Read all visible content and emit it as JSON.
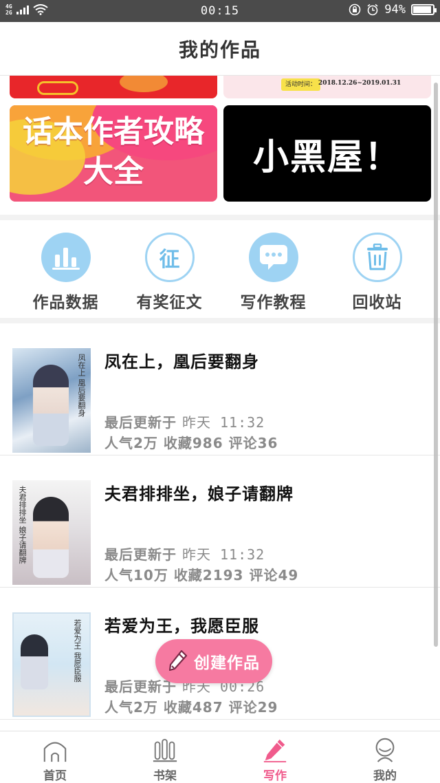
{
  "status_bar": {
    "network_top": "4G",
    "network_bottom": "2G",
    "time": "00:15",
    "battery": "94%",
    "battery_level": 0.94
  },
  "header": {
    "title": "我的作品"
  },
  "banners": {
    "strip_right_tag": "活动时间：",
    "strip_right_dates": "2018.12.26~2019.01.31",
    "pink_line1": "话本作者攻略",
    "pink_line2": "大全",
    "black_text": "小黑屋！"
  },
  "actions": [
    {
      "label": "作品数据",
      "icon": "chart-icon"
    },
    {
      "label": "有奖征文",
      "icon": "zheng-icon",
      "glyph": "征"
    },
    {
      "label": "写作教程",
      "icon": "message-icon"
    },
    {
      "label": "回收站",
      "icon": "trash-icon"
    }
  ],
  "works": [
    {
      "title": "凤在上，凰后要翻身",
      "updated_prefix": "最后更新于 ",
      "updated_time": "昨天 11:32",
      "popularity": "人气2万",
      "favorites": "收藏986",
      "comments": "评论36",
      "cover_text": "凤在上 凰后要翻身"
    },
    {
      "title": "夫君排排坐，娘子请翻牌",
      "updated_prefix": "最后更新于 ",
      "updated_time": "昨天 11:32",
      "popularity": "人气10万",
      "favorites": "收藏2193",
      "comments": "评论49",
      "cover_text": "夫君排排坐 娘子请翻牌"
    },
    {
      "title": "若爱为王，我愿臣服",
      "updated_prefix": "最后更新于 ",
      "updated_time": "昨天 00:26",
      "popularity": "人气2万",
      "favorites": "收藏487",
      "comments": "评论29",
      "cover_text": "若爱为王 我愿臣服"
    }
  ],
  "fab": {
    "label": "创建作品",
    "icon": "pencil-icon"
  },
  "tabs": [
    {
      "label": "首页",
      "icon": "home-icon",
      "active": false
    },
    {
      "label": "书架",
      "icon": "bookshelf-icon",
      "active": false
    },
    {
      "label": "写作",
      "icon": "pencil-icon",
      "active": true
    },
    {
      "label": "我的",
      "icon": "profile-icon",
      "active": false
    }
  ],
  "colors": {
    "accent": "#f05b8c",
    "fab": "#f67aa1",
    "icon_blue": "#9ed3f3",
    "status_bar": "#4b4b4b"
  }
}
